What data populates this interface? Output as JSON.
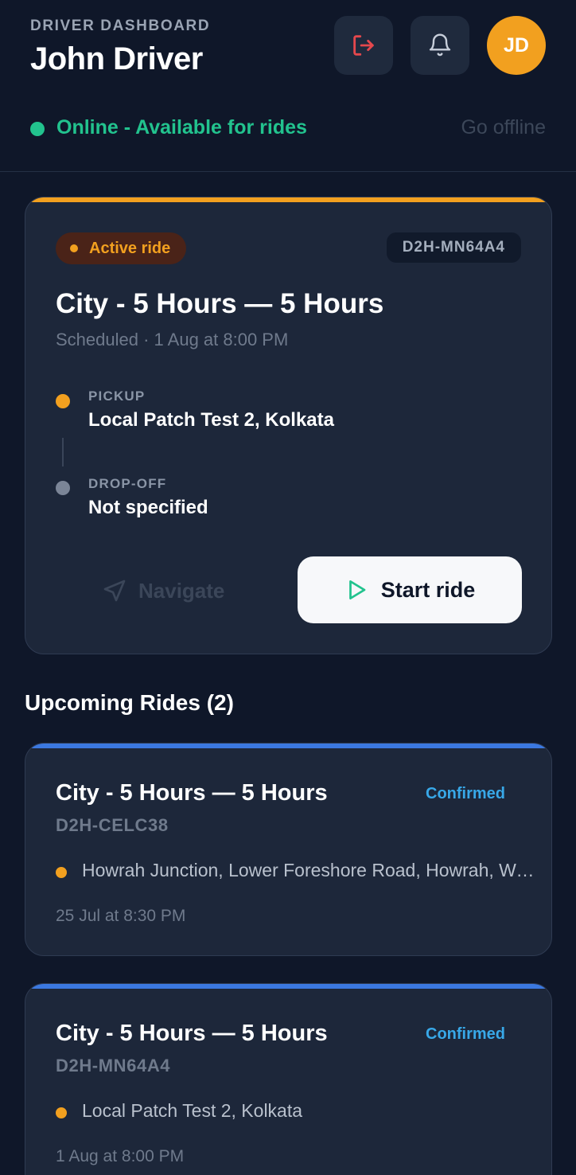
{
  "header": {
    "kicker": "DRIVER DASHBOARD",
    "driver_name": "John Driver",
    "avatar_initials": "JD",
    "icons": {
      "logout": "logout-icon",
      "notifications": "bell-icon"
    }
  },
  "status": {
    "text": "Online - Available for rides",
    "toggle_label": "Go offline",
    "color": "#22c38e"
  },
  "active_ride": {
    "badge": "Active ride",
    "code": "D2H-MN64A4",
    "title": "City - 5 Hours — 5 Hours",
    "subtitle": "Scheduled · 1 Aug at 8:00 PM",
    "pickup_label": "PICKUP",
    "pickup_value": "Local Patch Test 2, Kolkata",
    "dropoff_label": "DROP-OFF",
    "dropoff_value": "Not specified",
    "navigate_label": "Navigate",
    "start_label": "Start ride",
    "accent_color": "#f2a01f"
  },
  "upcoming": {
    "title": "Upcoming Rides (2)",
    "accent_color": "#3b78e0",
    "rides": [
      {
        "title": "City - 5 Hours — 5 Hours",
        "status": "Confirmed",
        "code": "D2H-CELC38",
        "location": "Howrah Junction, Lower Foreshore Road, Howrah, West Bengal",
        "time": "25 Jul at 8:30 PM"
      },
      {
        "title": "City - 5 Hours — 5 Hours",
        "status": "Confirmed",
        "code": "D2H-MN64A4",
        "location": "Local Patch Test 2, Kolkata",
        "time": "1 Aug at 8:00 PM"
      }
    ]
  }
}
